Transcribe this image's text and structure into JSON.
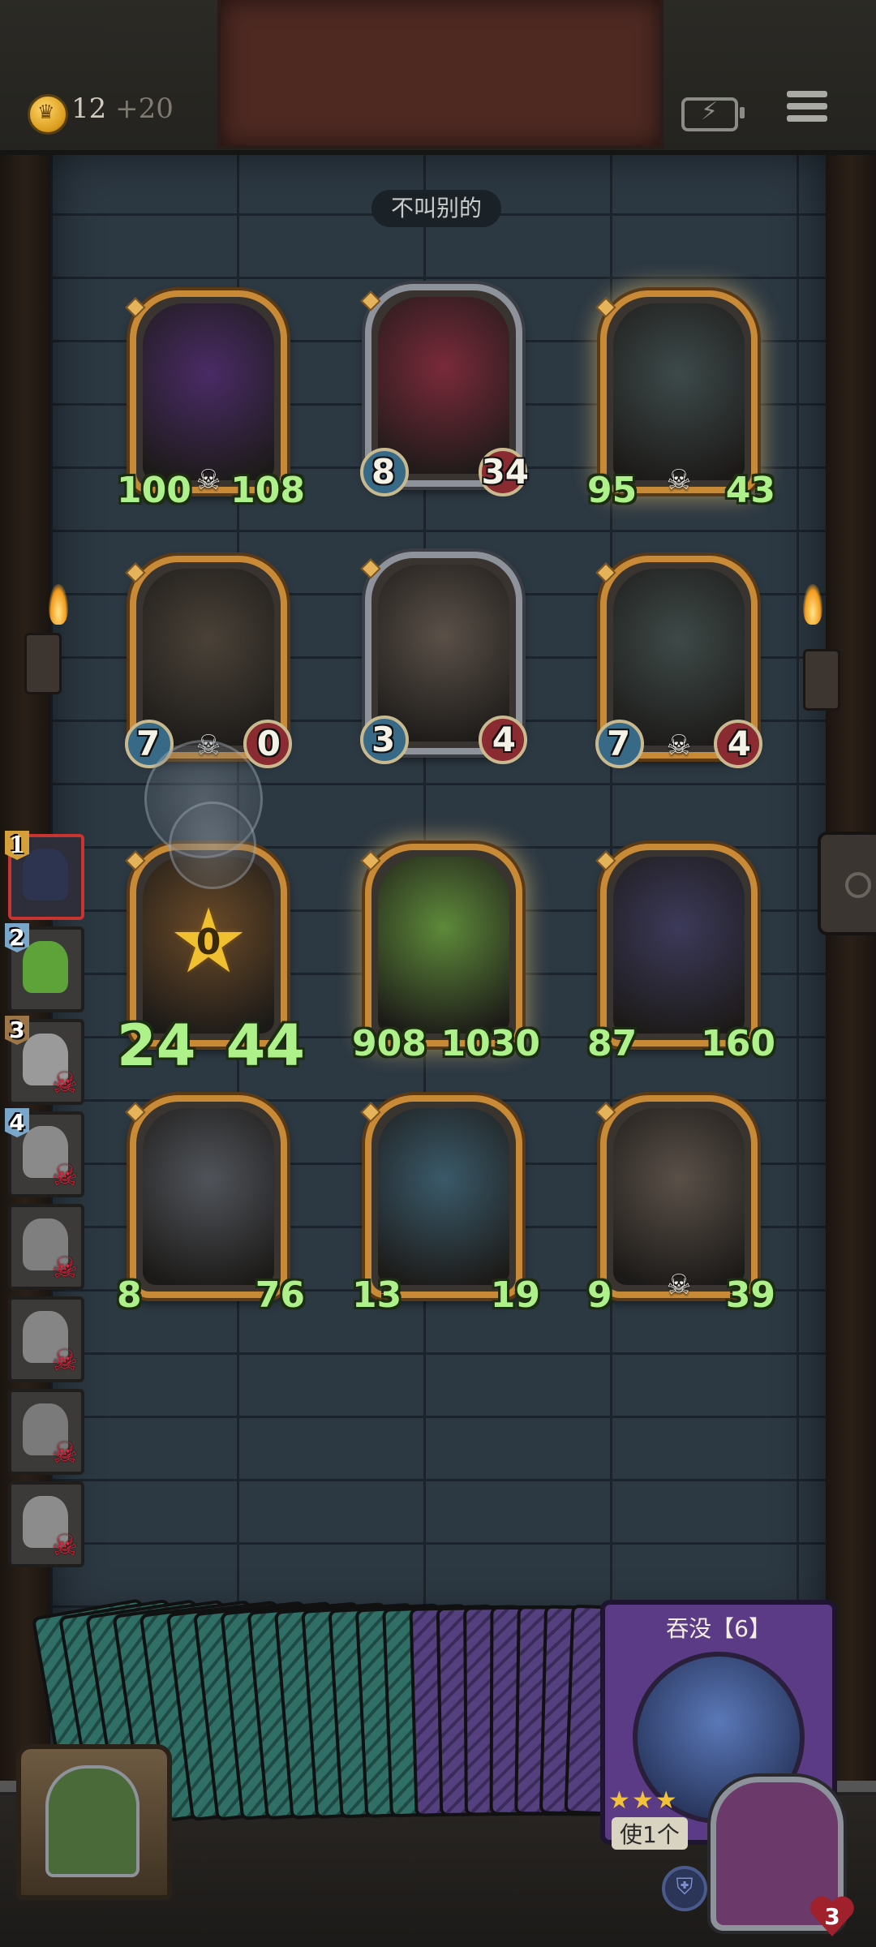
{
  "header": {
    "gold": "12",
    "gold_bonus": "+20",
    "phase_label": "不叫别的"
  },
  "board": [
    {
      "name": "dark-lich-card",
      "attack": "100",
      "health": "108",
      "frame": "gold",
      "skull": true,
      "art": "#4a2b66"
    },
    {
      "name": "clown-card",
      "attack": "8",
      "health": "34",
      "frame": "silver",
      "bubbles": true,
      "art": "#7a2a3a"
    },
    {
      "name": "ghost-cauldron-card",
      "attack": "95",
      "health": "43",
      "frame": "gold",
      "skull": true,
      "glow": true,
      "art": "#3d4a4a"
    },
    {
      "name": "drill-golem-card",
      "attack": "7",
      "health": "0",
      "frame": "gold",
      "bubbles": true,
      "skull": true,
      "art": "#4a4238"
    },
    {
      "name": "gargoyle-bat-card",
      "attack": "3",
      "health": "4",
      "frame": "silver",
      "bubbles": true,
      "art": "#5a5048"
    },
    {
      "name": "bell-tower-card",
      "attack": "7",
      "health": "4",
      "frame": "gold",
      "bubbles": true,
      "skull": true,
      "art": "#3e4a48"
    },
    {
      "name": "hooded-enchanted-card",
      "attack": "24",
      "health": "44",
      "frame": "gold",
      "big": true,
      "star": "0",
      "art": "#6a4a28"
    },
    {
      "name": "leaf-kid-card",
      "attack": "908",
      "health": "1030",
      "frame": "gold",
      "glow": true,
      "art": "#5e8a3a"
    },
    {
      "name": "dark-elf-card",
      "attack": "87",
      "health": "160",
      "frame": "gold",
      "art": "#3c3a5a"
    },
    {
      "name": "grey-dragon-card",
      "attack": "8",
      "health": "76",
      "frame": "gold",
      "art": "#50545a"
    },
    {
      "name": "blue-dragon-card",
      "attack": "13",
      "health": "19",
      "frame": "gold",
      "art": "#3a5a6a"
    },
    {
      "name": "bat-demon-card",
      "attack": "9",
      "health": "39",
      "frame": "gold",
      "skull": true,
      "art": "#5a5048"
    }
  ],
  "opponents": [
    {
      "rank": "1",
      "style": "gold",
      "active": true,
      "dead": false,
      "face": "#2c3450"
    },
    {
      "rank": "2",
      "style": "blue",
      "active": false,
      "dead": false,
      "face": "#5da33a"
    },
    {
      "rank": "3",
      "style": "bronze",
      "active": false,
      "dead": true,
      "face": "#9a9a9a"
    },
    {
      "rank": "4",
      "style": "blue",
      "active": false,
      "dead": true,
      "face": "#8a8a8a"
    },
    {
      "rank": "",
      "style": "",
      "active": false,
      "dead": true,
      "face": "#7f7f7f"
    },
    {
      "rank": "",
      "style": "",
      "active": false,
      "dead": true,
      "face": "#858585"
    },
    {
      "rank": "",
      "style": "",
      "active": false,
      "dead": true,
      "face": "#7a7a7a"
    },
    {
      "rank": "",
      "style": "",
      "active": false,
      "dead": true,
      "face": "#8c8c8c"
    }
  ],
  "deck": {
    "teal_count": 14,
    "purple_count": 7,
    "featured_name": "吞没【6】",
    "featured_stars": "★★★",
    "featured_desc": "使1个"
  },
  "player": {
    "health": "3"
  },
  "colors": {
    "frame_gold": "#c98a38",
    "frame_silver": "#8e929a",
    "stat_green": "#aef08a",
    "deck_teal": "#2f6f66",
    "deck_purple": "#55407f"
  }
}
